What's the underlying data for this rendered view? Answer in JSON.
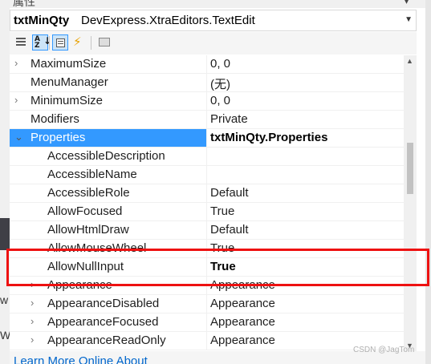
{
  "window": {
    "title_fragment": "属性",
    "pin_glyph": "▾"
  },
  "component_selector": {
    "name": "txtMinQty",
    "type": "DevExpress.XtraEditors.TextEdit"
  },
  "toolbar": {
    "buttons": [
      {
        "name": "categorized",
        "icon": "categorized-icon",
        "active": false
      },
      {
        "name": "alphabetical",
        "icon": "sort-az-icon",
        "active": true
      },
      {
        "name": "properties",
        "icon": "properties-icon",
        "active": true
      },
      {
        "name": "events",
        "icon": "lightning-icon",
        "active": false
      },
      {
        "name": "property-pages",
        "icon": "property-pages-icon",
        "active": false
      }
    ],
    "az_top": "A",
    "az_bottom": "Z",
    "az_arrow": "↓",
    "events_glyph": "⚡"
  },
  "grid": {
    "collapsed_glyph": "›",
    "expanded_glyph": "⌄",
    "rows": [
      {
        "name": "MaximumSize",
        "value": "0, 0"
      },
      {
        "name": "MenuManager",
        "value": "(无)"
      },
      {
        "name": "MinimumSize",
        "value": "0, 0"
      },
      {
        "name": "Modifiers",
        "value": "Private"
      },
      {
        "name": "Properties",
        "value": "txtMinQty.Properties"
      },
      {
        "name": "AccessibleDescription",
        "value": ""
      },
      {
        "name": "AccessibleName",
        "value": ""
      },
      {
        "name": "AccessibleRole",
        "value": "Default"
      },
      {
        "name": "AllowFocused",
        "value": "True"
      },
      {
        "name": "AllowHtmlDraw",
        "value": "Default"
      },
      {
        "name": "AllowMouseWheel",
        "value": "True"
      },
      {
        "name": "AllowNullInput",
        "value": "True"
      },
      {
        "name": "Appearance",
        "value": "Appearance"
      },
      {
        "name": "AppearanceDisabled",
        "value": "Appearance"
      },
      {
        "name": "AppearanceFocused",
        "value": "Appearance"
      },
      {
        "name": "AppearanceReadOnly",
        "value": "Appearance"
      }
    ]
  },
  "scrollbar": {
    "up": "▲",
    "down": "▼"
  },
  "footer": {
    "link_text": "Learn More Online  About"
  },
  "background": {
    "letter_1": "w",
    "letter_2": "W"
  },
  "watermark": "CSDN @JagTom",
  "colors": {
    "selection": "#3399ff",
    "highlight_box": "#ee1111",
    "link": "#0066cc"
  }
}
